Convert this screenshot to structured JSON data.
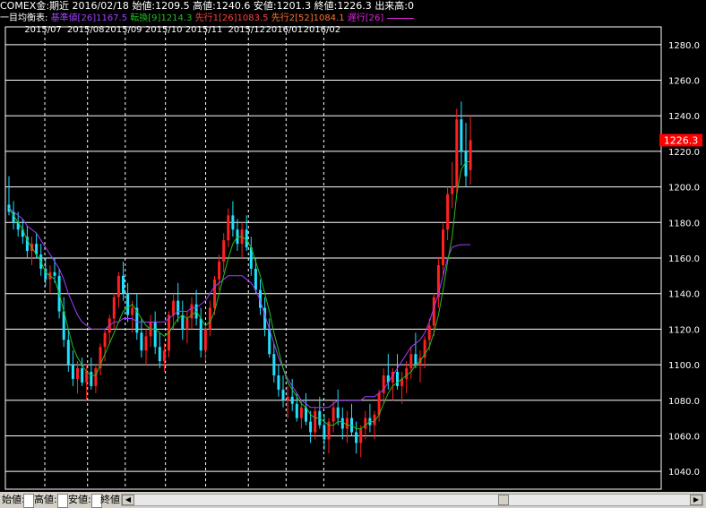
{
  "header": {
    "symbol": "COMEX金:期近",
    "date": "2016/02/18",
    "open_label": "始値:",
    "open": "1209.5",
    "high_label": "高値:",
    "high": "1240.6",
    "low_label": "安値:",
    "low": "1201.3",
    "close_label": "終値:",
    "close": "1226.3",
    "volume_label": "出来高:",
    "volume": "0"
  },
  "legend": {
    "prefix": "一目均衡表:",
    "kijun": "基準値[26]1167.5",
    "tenkan": "転換[9]1214.3",
    "senko1": "先行1[26]1083.5",
    "senko2": "先行2[52]1084.1",
    "chikou": "遅行[26]"
  },
  "colors": {
    "kijun": "#a040ff",
    "tenkan": "#20c020",
    "senko1": "#ff4040",
    "senko2": "#ff7030",
    "chikou": "#e020e0",
    "up_candle": "#ff2020",
    "down_candle": "#20e0ff",
    "cloud_bull": "#8b3a10",
    "cloud_bear": "#505050",
    "cloud_edge": "#ff7030",
    "grid": "#ffffff",
    "price_tag_bg": "#ff0000"
  },
  "bottom_bar": {
    "open_label": "始値:",
    "high_label": "高値:",
    "low_label": "安値:",
    "close_label": "終値:"
  },
  "chart_data": {
    "type": "candlestick",
    "ylim": [
      1030,
      1290
    ],
    "y_ticks": [
      "1280.0",
      "1260.0",
      "1240.0",
      "1220.0",
      "1200.0",
      "1180.0",
      "1160.0",
      "1140.0",
      "1120.0",
      "1100.0",
      "1080.0",
      "1060.0",
      "1040.0"
    ],
    "x_ticks": [
      "2015/07",
      "2015/08",
      "2015/09",
      "2015/10",
      "2015/11",
      "2015/12",
      "2016/01",
      "2016/02"
    ],
    "current_price_label": "1226.3",
    "current_price": 1226.3,
    "candles": [
      [
        1190,
        1206,
        1184,
        1186
      ],
      [
        1186,
        1192,
        1176,
        1180
      ],
      [
        1180,
        1186,
        1172,
        1176
      ],
      [
        1176,
        1182,
        1168,
        1172
      ],
      [
        1172,
        1178,
        1160,
        1164
      ],
      [
        1164,
        1172,
        1156,
        1168
      ],
      [
        1168,
        1174,
        1160,
        1162
      ],
      [
        1162,
        1168,
        1150,
        1154
      ],
      [
        1154,
        1160,
        1144,
        1148
      ],
      [
        1148,
        1156,
        1140,
        1152
      ],
      [
        1152,
        1160,
        1146,
        1150
      ],
      [
        1150,
        1154,
        1126,
        1130
      ],
      [
        1130,
        1138,
        1110,
        1114
      ],
      [
        1114,
        1120,
        1096,
        1100
      ],
      [
        1100,
        1108,
        1088,
        1092
      ],
      [
        1092,
        1102,
        1084,
        1098
      ],
      [
        1098,
        1104,
        1088,
        1090
      ],
      [
        1090,
        1100,
        1080,
        1096
      ],
      [
        1096,
        1104,
        1086,
        1088
      ],
      [
        1088,
        1100,
        1084,
        1098
      ],
      [
        1098,
        1112,
        1094,
        1110
      ],
      [
        1110,
        1120,
        1102,
        1118
      ],
      [
        1118,
        1128,
        1112,
        1126
      ],
      [
        1126,
        1140,
        1120,
        1138
      ],
      [
        1138,
        1152,
        1132,
        1150
      ],
      [
        1150,
        1158,
        1136,
        1140
      ],
      [
        1140,
        1146,
        1124,
        1128
      ],
      [
        1128,
        1136,
        1118,
        1132
      ],
      [
        1132,
        1140,
        1114,
        1118
      ],
      [
        1118,
        1126,
        1104,
        1108
      ],
      [
        1108,
        1120,
        1100,
        1116
      ],
      [
        1116,
        1128,
        1110,
        1124
      ],
      [
        1124,
        1130,
        1106,
        1110
      ],
      [
        1110,
        1118,
        1098,
        1102
      ],
      [
        1102,
        1112,
        1096,
        1108
      ],
      [
        1108,
        1130,
        1104,
        1128
      ],
      [
        1128,
        1140,
        1120,
        1136
      ],
      [
        1136,
        1146,
        1124,
        1128
      ],
      [
        1128,
        1136,
        1114,
        1120
      ],
      [
        1120,
        1130,
        1112,
        1126
      ],
      [
        1126,
        1138,
        1120,
        1134
      ],
      [
        1134,
        1142,
        1122,
        1126
      ],
      [
        1126,
        1132,
        1104,
        1108
      ],
      [
        1108,
        1122,
        1102,
        1120
      ],
      [
        1120,
        1136,
        1116,
        1132
      ],
      [
        1132,
        1150,
        1128,
        1148
      ],
      [
        1148,
        1162,
        1142,
        1158
      ],
      [
        1158,
        1174,
        1152,
        1170
      ],
      [
        1170,
        1188,
        1166,
        1184
      ],
      [
        1184,
        1192,
        1172,
        1176
      ],
      [
        1176,
        1182,
        1164,
        1168
      ],
      [
        1168,
        1180,
        1160,
        1176
      ],
      [
        1176,
        1184,
        1164,
        1166
      ],
      [
        1166,
        1172,
        1150,
        1154
      ],
      [
        1154,
        1160,
        1140,
        1142
      ],
      [
        1142,
        1148,
        1128,
        1132
      ],
      [
        1132,
        1138,
        1116,
        1120
      ],
      [
        1120,
        1126,
        1104,
        1106
      ],
      [
        1106,
        1112,
        1090,
        1094
      ],
      [
        1094,
        1100,
        1082,
        1086
      ],
      [
        1086,
        1094,
        1076,
        1080
      ],
      [
        1080,
        1088,
        1070,
        1082
      ],
      [
        1082,
        1092,
        1074,
        1078
      ],
      [
        1078,
        1084,
        1068,
        1070
      ],
      [
        1070,
        1080,
        1064,
        1076
      ],
      [
        1076,
        1084,
        1066,
        1068
      ],
      [
        1068,
        1074,
        1056,
        1062
      ],
      [
        1062,
        1076,
        1058,
        1074
      ],
      [
        1074,
        1082,
        1064,
        1066
      ],
      [
        1066,
        1072,
        1052,
        1058
      ],
      [
        1058,
        1070,
        1050,
        1068
      ],
      [
        1068,
        1080,
        1062,
        1076
      ],
      [
        1076,
        1086,
        1066,
        1070
      ],
      [
        1070,
        1076,
        1058,
        1064
      ],
      [
        1064,
        1074,
        1056,
        1070
      ],
      [
        1070,
        1078,
        1060,
        1062
      ],
      [
        1062,
        1068,
        1050,
        1056
      ],
      [
        1056,
        1066,
        1048,
        1064
      ],
      [
        1064,
        1074,
        1058,
        1070
      ],
      [
        1070,
        1078,
        1062,
        1066
      ],
      [
        1066,
        1074,
        1058,
        1072
      ],
      [
        1072,
        1086,
        1068,
        1084
      ],
      [
        1084,
        1098,
        1078,
        1094
      ],
      [
        1094,
        1106,
        1086,
        1090
      ],
      [
        1090,
        1098,
        1080,
        1096
      ],
      [
        1096,
        1106,
        1086,
        1088
      ],
      [
        1088,
        1096,
        1078,
        1092
      ],
      [
        1092,
        1102,
        1084,
        1098
      ],
      [
        1098,
        1110,
        1092,
        1106
      ],
      [
        1106,
        1118,
        1098,
        1100
      ],
      [
        1100,
        1108,
        1090,
        1104
      ],
      [
        1104,
        1116,
        1098,
        1114
      ],
      [
        1114,
        1126,
        1108,
        1122
      ],
      [
        1122,
        1140,
        1116,
        1138
      ],
      [
        1138,
        1160,
        1132,
        1156
      ],
      [
        1156,
        1180,
        1150,
        1176
      ],
      [
        1176,
        1200,
        1170,
        1196
      ],
      [
        1196,
        1214,
        1188,
        1200
      ],
      [
        1200,
        1244,
        1196,
        1238
      ],
      [
        1238,
        1248,
        1212,
        1220
      ],
      [
        1220,
        1236,
        1200,
        1206
      ],
      [
        1209.5,
        1240.6,
        1201.3,
        1226.3
      ]
    ],
    "tenkan_values": [
      1188,
      1184,
      1180,
      1176,
      1170,
      1166,
      1162,
      1158,
      1152,
      1150,
      1148,
      1140,
      1130,
      1120,
      1110,
      1104,
      1100,
      1096,
      1094,
      1094,
      1100,
      1106,
      1112,
      1118,
      1124,
      1130,
      1132,
      1134,
      1130,
      1126,
      1122,
      1120,
      1120,
      1118,
      1116,
      1118,
      1122,
      1126,
      1128,
      1126,
      1128,
      1130,
      1126,
      1122,
      1124,
      1130,
      1140,
      1150,
      1160,
      1168,
      1172,
      1172,
      1170,
      1166,
      1158,
      1150,
      1140,
      1130,
      1118,
      1108,
      1098,
      1090,
      1086,
      1082,
      1078,
      1076,
      1072,
      1070,
      1070,
      1068,
      1066,
      1066,
      1068,
      1068,
      1066,
      1066,
      1064,
      1064,
      1066,
      1068,
      1068,
      1072,
      1078,
      1084,
      1088,
      1090,
      1092,
      1094,
      1096,
      1100,
      1102,
      1106,
      1110,
      1118,
      1128,
      1142,
      1158,
      1172,
      1196,
      1210,
      1214,
      1214.3
    ],
    "kijun_values": [
      1188,
      1186,
      1184,
      1182,
      1178,
      1176,
      1174,
      1170,
      1166,
      1162,
      1158,
      1154,
      1148,
      1140,
      1134,
      1128,
      1124,
      1122,
      1120,
      1120,
      1120,
      1120,
      1122,
      1124,
      1124,
      1126,
      1126,
      1126,
      1124,
      1124,
      1124,
      1124,
      1124,
      1124,
      1124,
      1126,
      1128,
      1130,
      1130,
      1130,
      1132,
      1132,
      1134,
      1136,
      1140,
      1144,
      1146,
      1148,
      1150,
      1150,
      1150,
      1150,
      1148,
      1146,
      1142,
      1136,
      1128,
      1120,
      1112,
      1104,
      1098,
      1092,
      1088,
      1084,
      1080,
      1078,
      1076,
      1076,
      1076,
      1076,
      1076,
      1078,
      1080,
      1080,
      1080,
      1080,
      1080,
      1080,
      1082,
      1082,
      1082,
      1084,
      1086,
      1090,
      1094,
      1098,
      1102,
      1106,
      1110,
      1112,
      1114,
      1118,
      1124,
      1132,
      1140,
      1150,
      1160,
      1166,
      1167,
      1167.5,
      1167.5,
      1167.5
    ]
  }
}
